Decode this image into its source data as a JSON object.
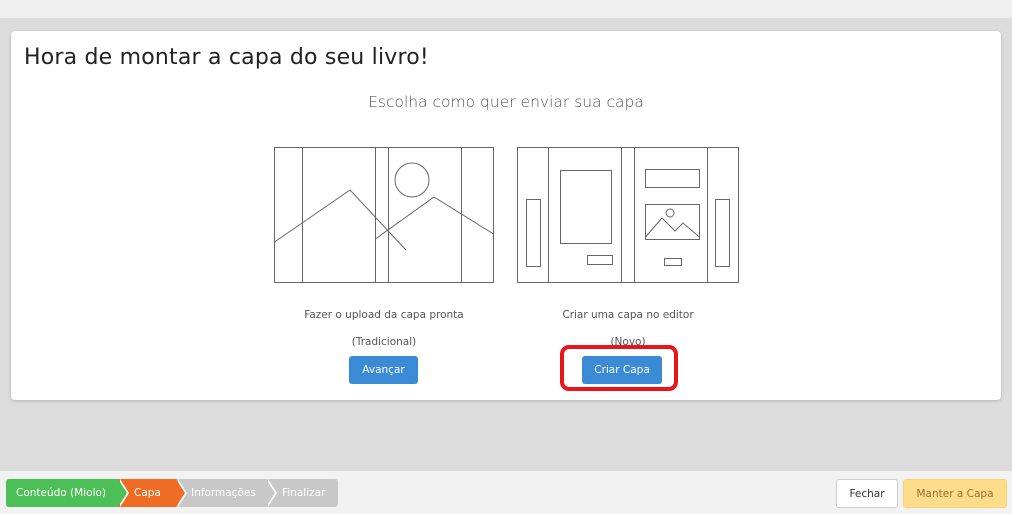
{
  "page": {
    "title": "Hora de montar a capa do seu livro!",
    "subtitle": "Escolha como quer enviar sua capa"
  },
  "options": [
    {
      "label": "Fazer o upload da capa pronta",
      "tag": "(Tradicional)",
      "button_label": "Avançar",
      "icon": "traditional-cover-illustration"
    },
    {
      "label": "Criar uma capa no editor",
      "tag": "(Novo)",
      "button_label": "Criar Capa",
      "icon": "editor-cover-illustration",
      "highlighted": true
    }
  ],
  "footer": {
    "steps": [
      {
        "label": "Conteúdo (Miolo)",
        "state": "done"
      },
      {
        "label": "Capa",
        "state": "active"
      },
      {
        "label": "Informações",
        "state": "pending"
      },
      {
        "label": "Finalizar",
        "state": "pending"
      }
    ],
    "close_label": "Fechar",
    "keep_label": "Manter a Capa"
  },
  "colors": {
    "primary_button": "#3a8ad6",
    "step_done": "#4cbf57",
    "step_active": "#f06b24",
    "step_pending": "#c8c8c8",
    "keep_button": "#fedd8a",
    "highlight": "#e8151b"
  }
}
